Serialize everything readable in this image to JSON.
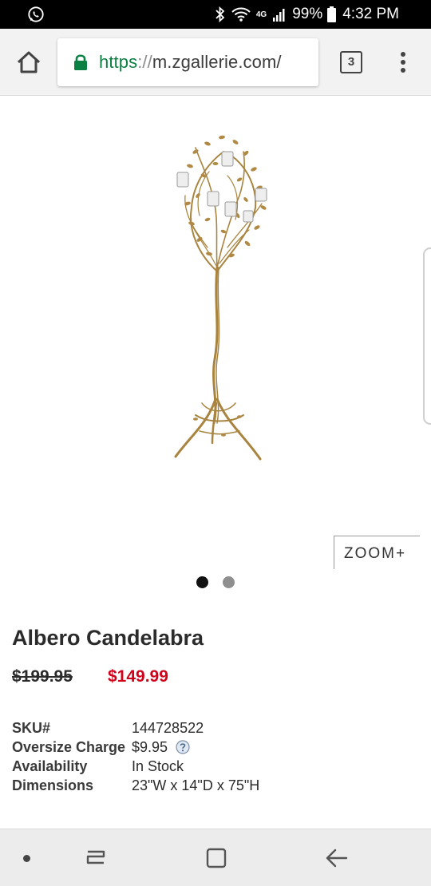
{
  "status_bar": {
    "battery": "99%",
    "time": "4:32 PM",
    "network": "4G"
  },
  "browser": {
    "url_scheme": "https",
    "url_separator": "://",
    "url_host": "m.zgallerie.com/",
    "tab_count": "3"
  },
  "gallery": {
    "zoom_label": "ZOOM+",
    "slide_count": 2,
    "active_slide": 1
  },
  "product": {
    "title": "Albero Candelabra",
    "original_price": "$199.95",
    "sale_price": "$149.99",
    "specs": [
      {
        "label": "SKU#",
        "value": "144728522"
      },
      {
        "label": "Oversize Charge",
        "value": "$9.95"
      },
      {
        "label": "Availability",
        "value": "In Stock"
      },
      {
        "label": "Dimensions",
        "value": "23\"W x 14\"D x 75\"H"
      }
    ]
  },
  "colors": {
    "sale_red": "#d0021b",
    "secure_green": "#0b8043",
    "gold": "#b08a45"
  },
  "icons": {
    "status_left": "whatsapp-icon",
    "bluetooth": "bluetooth-icon",
    "wifi": "wifi-icon",
    "signal": "signal-icon",
    "battery": "battery-icon",
    "home": "home-icon",
    "lock": "lock-icon",
    "menu": "more-vert-icon",
    "help": "help-icon"
  }
}
